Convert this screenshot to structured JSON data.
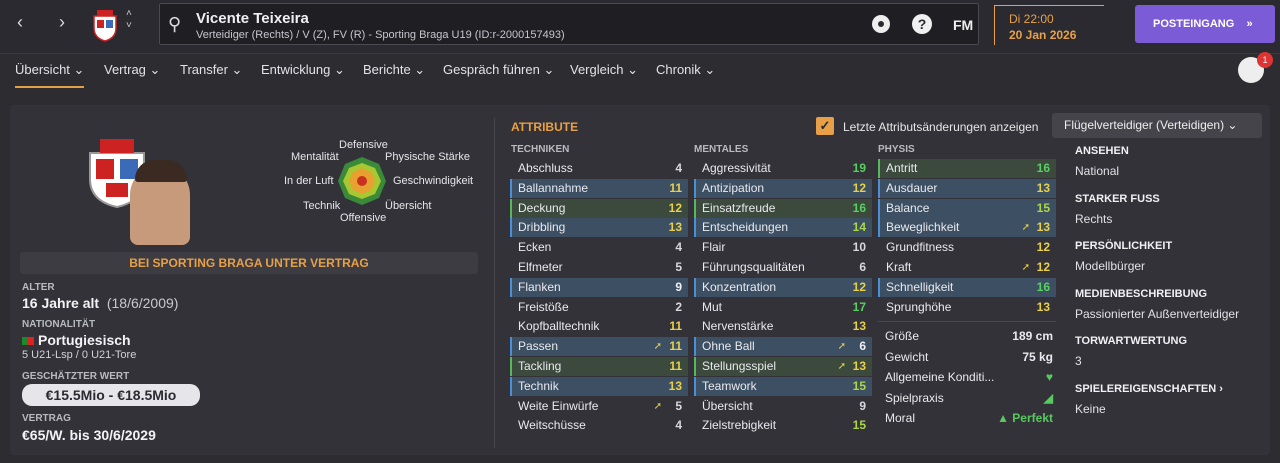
{
  "header": {
    "player_name": "Vicente Teixeira",
    "player_desc": "Verteidiger (Rechts) / V (Z), FV (R) - Sporting Braga U19 (ID:r-2000157493)",
    "fm_label": "FM",
    "day_time": "Di 22:00",
    "date": "20 Jan 2026",
    "inbox_label": "POSTEINGANG",
    "inbox_arrow": "»",
    "back": "‹",
    "forward": "›",
    "up": "˄",
    "down": "˅",
    "help": "?",
    "search": "⚲",
    "notif_count": "1"
  },
  "tabs": [
    {
      "label": "Übersicht ⌄"
    },
    {
      "label": "Vertrag ⌄"
    },
    {
      "label": "Transfer ⌄"
    },
    {
      "label": "Entwicklung ⌄"
    },
    {
      "label": "Berichte ⌄"
    },
    {
      "label": "Gespräch führen ⌄"
    },
    {
      "label": "Vergleich ⌄"
    },
    {
      "label": "Chronik ⌄"
    }
  ],
  "radar": {
    "labels": [
      "Defensive",
      "Mentalität",
      "Physische Stärke",
      "In der Luft",
      "Geschwindigkeit",
      "Technik",
      "Übersicht",
      "Offensive"
    ]
  },
  "profile": {
    "contract_banner": "BEI SPORTING BRAGA UNTER VERTRAG",
    "age_label": "ALTER",
    "age_value": "16 Jahre alt",
    "birth": "(18/6/2009)",
    "nat_label": "NATIONALITÄT",
    "nat_value": "Portugiesisch",
    "caps": "5 U21-Lsp / 0 U21-Tore",
    "value_label": "GESCHÄTZTER WERT",
    "value": "€15.5Mio - €18.5Mio",
    "contract_label": "VERTRAG",
    "contract_value": "€65/W. bis 30/6/2029"
  },
  "attributes": {
    "title": "ATTRIBUTE",
    "show_changes": "Letzte Attributsänderungen anzeigen",
    "checkmark": "✓",
    "role": "Flügelverteidiger (Verteidigen) ⌄",
    "technik_head": "TECHNIKEN",
    "mental_head": "MENTALES",
    "physis_head": "PHYSIS",
    "trend_glyph": "➚",
    "technik": [
      {
        "n": "Abschluss",
        "v": "4",
        "h": false,
        "t": false
      },
      {
        "n": "Ballannahme",
        "v": "11",
        "h": true,
        "t": false
      },
      {
        "n": "Deckung",
        "v": "12",
        "h": true,
        "t": false,
        "p": true
      },
      {
        "n": "Dribbling",
        "v": "13",
        "h": true,
        "t": false
      },
      {
        "n": "Ecken",
        "v": "4",
        "h": false,
        "t": false
      },
      {
        "n": "Elfmeter",
        "v": "5",
        "h": false,
        "t": false
      },
      {
        "n": "Flanken",
        "v": "9",
        "h": true,
        "t": false
      },
      {
        "n": "Freistöße",
        "v": "2",
        "h": false,
        "t": false
      },
      {
        "n": "Kopfballtechnik",
        "v": "11",
        "h": false,
        "t": false
      },
      {
        "n": "Passen",
        "v": "11",
        "h": true,
        "t": true
      },
      {
        "n": "Tackling",
        "v": "11",
        "h": true,
        "t": false,
        "p": true
      },
      {
        "n": "Technik",
        "v": "13",
        "h": true,
        "t": false
      },
      {
        "n": "Weite Einwürfe",
        "v": "5",
        "h": false,
        "t": true
      },
      {
        "n": "Weitschüsse",
        "v": "4",
        "h": false,
        "t": false
      }
    ],
    "mentales": [
      {
        "n": "Aggressivität",
        "v": "19",
        "h": false,
        "t": false
      },
      {
        "n": "Antizipation",
        "v": "12",
        "h": true,
        "t": false
      },
      {
        "n": "Einsatzfreude",
        "v": "16",
        "h": true,
        "t": false,
        "p": true
      },
      {
        "n": "Entscheidungen",
        "v": "14",
        "h": true,
        "t": false
      },
      {
        "n": "Flair",
        "v": "10",
        "h": false,
        "t": false
      },
      {
        "n": "Führungsqualitäten",
        "v": "6",
        "h": false,
        "t": false
      },
      {
        "n": "Konzentration",
        "v": "12",
        "h": true,
        "t": false
      },
      {
        "n": "Mut",
        "v": "17",
        "h": false,
        "t": false
      },
      {
        "n": "Nervenstärke",
        "v": "13",
        "h": false,
        "t": false
      },
      {
        "n": "Ohne Ball",
        "v": "6",
        "h": true,
        "t": true
      },
      {
        "n": "Stellungsspiel",
        "v": "13",
        "h": true,
        "t": true,
        "p": true
      },
      {
        "n": "Teamwork",
        "v": "15",
        "h": true,
        "t": false
      },
      {
        "n": "Übersicht",
        "v": "9",
        "h": false,
        "t": false
      },
      {
        "n": "Zielstrebigkeit",
        "v": "15",
        "h": false,
        "t": false
      }
    ],
    "physis": [
      {
        "n": "Antritt",
        "v": "16",
        "h": true,
        "t": false,
        "p": true
      },
      {
        "n": "Ausdauer",
        "v": "13",
        "h": true,
        "t": false
      },
      {
        "n": "Balance",
        "v": "15",
        "h": true,
        "t": false
      },
      {
        "n": "Beweglichkeit",
        "v": "13",
        "h": true,
        "t": true
      },
      {
        "n": "Grundfitness",
        "v": "12",
        "h": false,
        "t": false
      },
      {
        "n": "Kraft",
        "v": "12",
        "h": false,
        "t": true
      },
      {
        "n": "Schnelligkeit",
        "v": "16",
        "h": true,
        "t": false
      },
      {
        "n": "Sprunghöhe",
        "v": "13",
        "h": false,
        "t": false
      }
    ]
  },
  "physical_info": [
    {
      "n": "Größe",
      "v": "189 cm"
    },
    {
      "n": "Gewicht",
      "v": "75 kg"
    },
    {
      "n": "Allgemeine Konditi...",
      "v": "♥"
    },
    {
      "n": "Spielpraxis",
      "v": "◢"
    },
    {
      "n": "Moral",
      "v": "▲ Perfekt"
    }
  ],
  "right_info": [
    {
      "h": "ANSEHEN",
      "v": "National"
    },
    {
      "h": "STARKER FUSS",
      "v": "Rechts"
    },
    {
      "h": "PERSÖNLICHKEIT",
      "v": "Modellbürger"
    },
    {
      "h": "MEDIENBESCHREIBUNG",
      "v": "Passionierter Außenverteidiger"
    },
    {
      "h": "TORWARTWERTUNG",
      "v": "3"
    },
    {
      "h": "SPIELEREIGENSCHAFTEN ›",
      "v": "Keine"
    }
  ],
  "colors": {
    "accent": "#e8a048",
    "inbox": "#7c5cd6",
    "good": "#58c860"
  }
}
